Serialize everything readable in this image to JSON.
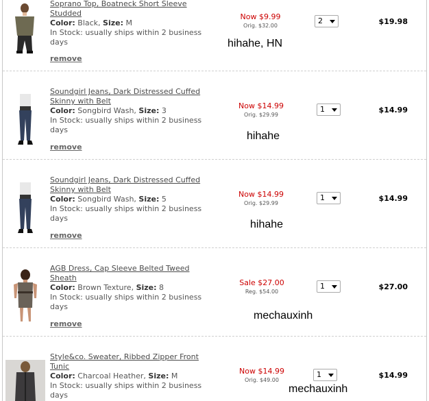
{
  "labels": {
    "color": "Color:",
    "size": "Size:"
  },
  "items": [
    {
      "title": "Soprano Top, Boatneck Short Sleeve Studded",
      "color": "Black",
      "size": "M",
      "stock": "In Stock: usually ships within 2 business days",
      "remove": "remove",
      "price_now": "Now $9.99",
      "price_orig": "Orig. $32.00",
      "qty": "2",
      "total": "$19.98",
      "note": "hihahe, HN"
    },
    {
      "title": "Soundgirl Jeans, Dark Distressed Cuffed Skinny with Belt",
      "color": "Songbird Wash",
      "size": "3",
      "stock": "In Stock: usually ships within 2 business days",
      "remove": "remove",
      "price_now": "Now $14.99",
      "price_orig": "Orig. $29.99",
      "qty": "1",
      "total": "$14.99",
      "note": "hihahe"
    },
    {
      "title": "Soundgirl Jeans, Dark Distressed Cuffed Skinny with Belt",
      "color": "Songbird Wash",
      "size": "5",
      "stock": "In Stock: usually ships within 2 business days",
      "remove": "remove",
      "price_now": "Now $14.99",
      "price_orig": "Orig. $29.99",
      "qty": "1",
      "total": "$14.99",
      "note": "hihahe"
    },
    {
      "title": "AGB Dress, Cap Sleeve Belted Tweed Sheath",
      "color": "Brown Texture",
      "size": "8",
      "stock": "In Stock: usually ships within 2 business days",
      "remove": "remove",
      "price_now": "Sale $27.00",
      "price_orig": "Reg. $54.00",
      "qty": "1",
      "total": "$27.00",
      "note": "mechauxinh"
    },
    {
      "title": "Style&co. Sweater, Ribbed Zipper Front Tunic",
      "color": "Charcoal Heather",
      "size": "M",
      "stock": "In Stock: usually ships within 2 business days",
      "remove": "",
      "price_now": "Now $14.99",
      "price_orig": "Orig. $49.00",
      "qty": "1",
      "total": "$14.99",
      "note": "mechauxinh"
    }
  ]
}
